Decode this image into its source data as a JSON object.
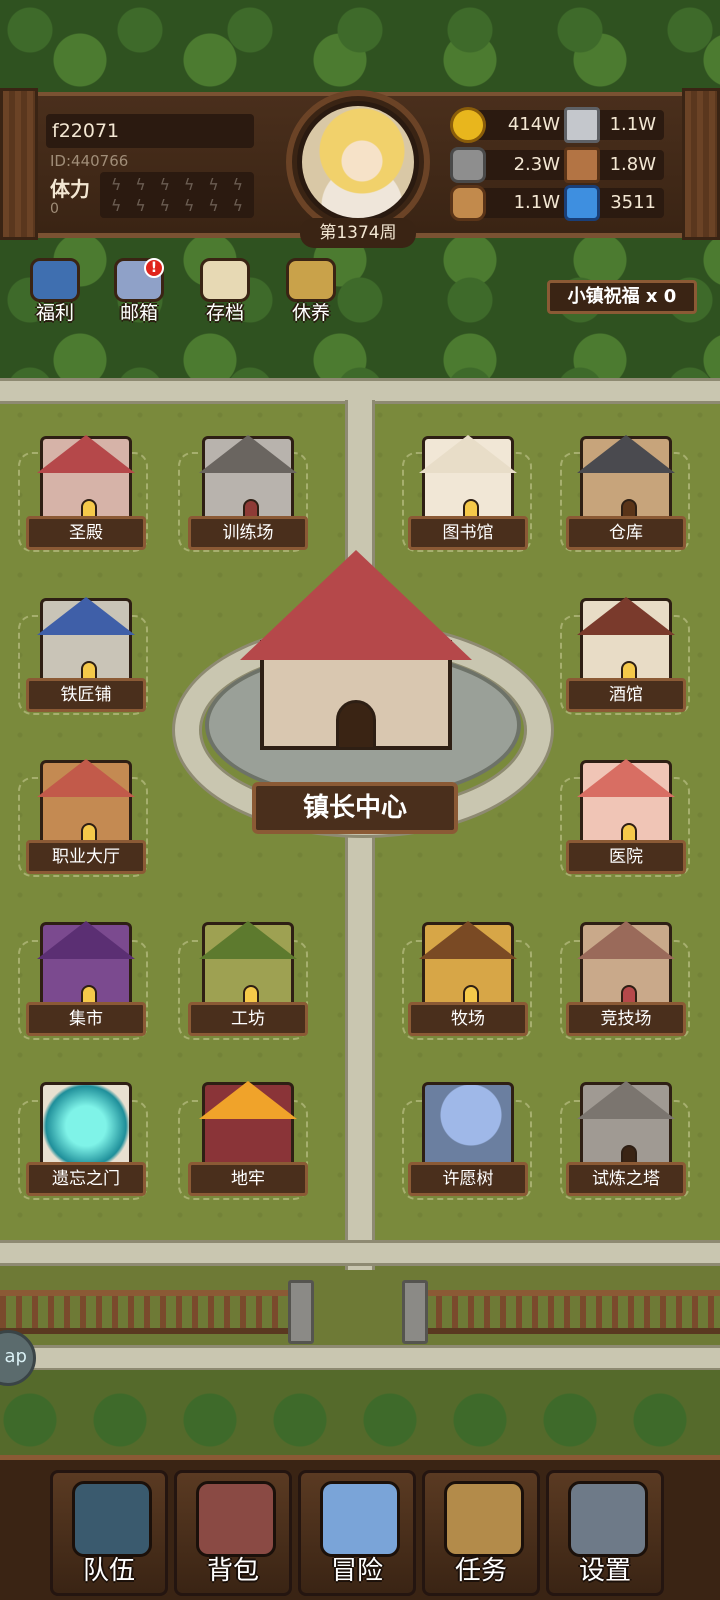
{
  "player": {
    "name": "f22071",
    "id": "ID:440766",
    "stamina_label": "体力",
    "stamina_value": "0",
    "week": "第1374周"
  },
  "resources": [
    {
      "name": "gold",
      "icon": "gold-coin-icon",
      "value": "414W"
    },
    {
      "name": "iron",
      "icon": "iron-ingot-icon",
      "value": "1.1W"
    },
    {
      "name": "stone",
      "icon": "stone-ore-icon",
      "value": "2.3W"
    },
    {
      "name": "leather",
      "icon": "leather-icon",
      "value": "1.8W"
    },
    {
      "name": "wood",
      "icon": "wood-log-icon",
      "value": "1.1W"
    },
    {
      "name": "crystal",
      "icon": "blue-crystal-icon",
      "value": "3511"
    }
  ],
  "quick": [
    {
      "label": "福利",
      "icon": "shield-icon"
    },
    {
      "label": "邮箱",
      "icon": "mail-icon",
      "badge": "!"
    },
    {
      "label": "存档",
      "icon": "scroll-icon"
    },
    {
      "label": "休养",
      "icon": "rest-scroll-icon"
    }
  ],
  "blessing": "小镇祝福 x 0",
  "buildings": [
    {
      "name": "圣殿"
    },
    {
      "name": "训练场"
    },
    {
      "name": "图书馆"
    },
    {
      "name": "仓库"
    },
    {
      "name": "铁匠铺"
    },
    {
      "name": "酒馆"
    },
    {
      "name": "职业大厅"
    },
    {
      "name": "医院"
    },
    {
      "name": "集市"
    },
    {
      "name": "工坊"
    },
    {
      "name": "牧场"
    },
    {
      "name": "竞技场"
    },
    {
      "name": "遗忘之门"
    },
    {
      "name": "地牢"
    },
    {
      "name": "许愿树"
    },
    {
      "name": "试炼之塔"
    }
  ],
  "townhall": "镇长中心",
  "side_tab": "ap",
  "nav": [
    {
      "label": "队伍",
      "icon": "helmet-icon"
    },
    {
      "label": "背包",
      "icon": "backpack-icon"
    },
    {
      "label": "冒险",
      "icon": "crossed-swords-icon"
    },
    {
      "label": "任务",
      "icon": "quest-scroll-icon"
    },
    {
      "label": "设置",
      "icon": "gear-icon"
    }
  ],
  "colors": {
    "wood_dark": "#3a2414",
    "wood_light": "#8b5a35",
    "grass": "#7a8a3c",
    "road": "#c9c6b0",
    "roof_red": "#b5484a"
  }
}
